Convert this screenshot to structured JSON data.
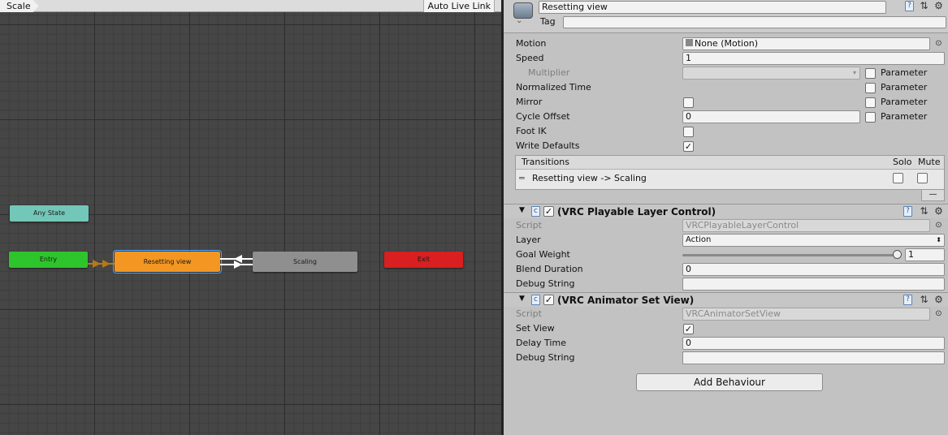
{
  "graph": {
    "breadcrumb": "Scale",
    "auto_live_link": "Auto Live Link",
    "states": {
      "any_state": "Any State",
      "entry": "Entry",
      "resetting_view": "Resetting view",
      "scaling": "Scaling",
      "exit": "Exit"
    }
  },
  "colors": {
    "any_state": "#73c7b8",
    "entry": "#2ec42b",
    "resetting_view": "#f39622",
    "scaling": "#8f8f8f",
    "exit": "#d91f1f",
    "selection": "#4aa6ff"
  },
  "inspector": {
    "state_name": "Resetting view",
    "tag_label": "Tag",
    "tag_value": "",
    "motion_label": "Motion",
    "motion_value": "None (Motion)",
    "speed_label": "Speed",
    "speed_value": "1",
    "multiplier_label": "Multiplier",
    "normalized_time_label": "Normalized Time",
    "mirror_label": "Mirror",
    "cycle_offset_label": "Cycle Offset",
    "cycle_offset_value": "0",
    "foot_ik_label": "Foot IK",
    "write_defaults_label": "Write Defaults",
    "parameter_label": "Parameter",
    "mirror_checked": false,
    "foot_ik_checked": false,
    "write_defaults_checked": true,
    "transitions": {
      "header": "Transitions",
      "solo": "Solo",
      "mute": "Mute",
      "items": [
        "Resetting view -> Scaling"
      ],
      "remove": "—"
    },
    "components": [
      {
        "title": "(VRC Playable Layer Control)",
        "enabled": true,
        "script_label": "Script",
        "script_value": "VRCPlayableLayerControl",
        "layer_label": "Layer",
        "layer_value": "Action",
        "goal_weight_label": "Goal Weight",
        "goal_weight_value": "1",
        "blend_duration_label": "Blend Duration",
        "blend_duration_value": "0",
        "debug_string_label": "Debug String",
        "debug_string_value": ""
      },
      {
        "title": "(VRC Animator Set View)",
        "enabled": true,
        "script_label": "Script",
        "script_value": "VRCAnimatorSetView",
        "set_view_label": "Set View",
        "set_view_checked": true,
        "delay_time_label": "Delay Time",
        "delay_time_value": "0",
        "debug_string_label": "Debug String",
        "debug_string_value": ""
      }
    ],
    "add_behaviour": "Add Behaviour"
  }
}
